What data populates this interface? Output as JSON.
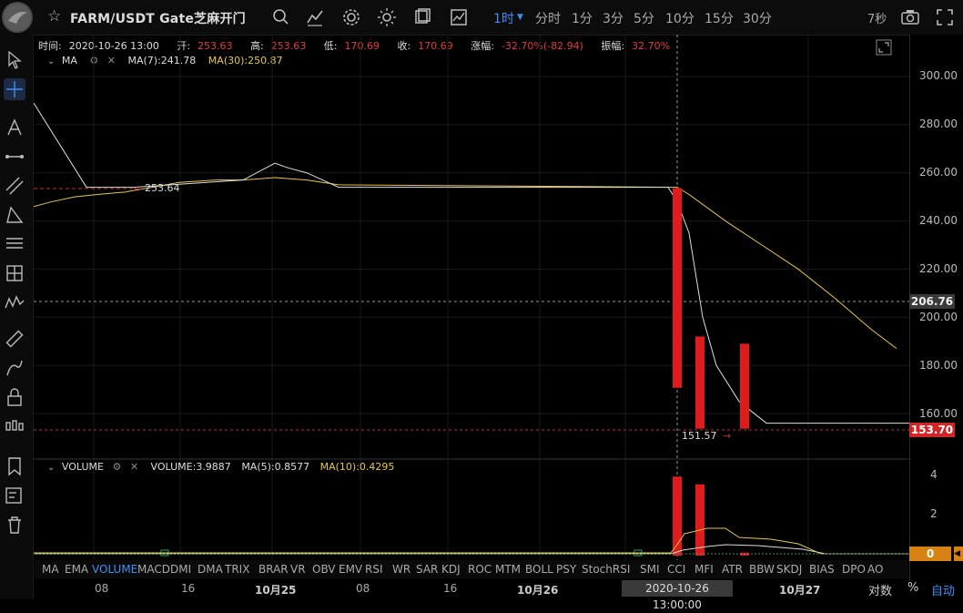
{
  "header": {
    "symbol": "FARM/USDT Gate芝麻开门",
    "timeframes": [
      {
        "label": "1时",
        "active": true
      },
      {
        "label": "分时"
      },
      {
        "label": "1分"
      },
      {
        "label": "3分"
      },
      {
        "label": "5分"
      },
      {
        "label": "10分"
      },
      {
        "label": "15分"
      },
      {
        "label": "30分"
      }
    ],
    "refresh": "7秒",
    "icons": [
      "star-icon",
      "search-icon",
      "indicator-icon",
      "settings-icon",
      "theme-icon",
      "copy-icon",
      "chart-icon",
      "camera-icon",
      "fullscreen-icon"
    ]
  },
  "ohlc": {
    "time_label": "时间:",
    "time": "2020-10-26 13:00",
    "open_label": "开:",
    "open": "253.63",
    "high_label": "高:",
    "high": "253.63",
    "low_label": "低:",
    "low": "170.69",
    "close_label": "收:",
    "close": "170.69",
    "change_label": "涨幅:",
    "change": "-32.70%(-82.94)",
    "amp_label": "振幅:",
    "amp": "32.70%"
  },
  "ma_legend": {
    "name": "MA",
    "ma7": "MA(7):241.78",
    "ma30": "MA(30):250.87"
  },
  "vol_legend": {
    "name": "VOLUME",
    "vol": "VOLUME:3.9887",
    "ma5": "MA(5):0.8577",
    "ma10": "MA(10):0.4295"
  },
  "price_axis": {
    "labels": [
      "300.00",
      "280.00",
      "260.00",
      "240.00",
      "220.00",
      "200.00",
      "180.00",
      "160.00"
    ],
    "crosshair_price": "206.76",
    "last_price": "153.70",
    "high_annotation": "253.64",
    "low_annotation": "151.57"
  },
  "volume_axis": {
    "labels": [
      "4",
      "2"
    ],
    "last_volume": "0"
  },
  "indicators": [
    "MA",
    "EMA",
    "VOLUME",
    "MACD",
    "DMI",
    "DMA",
    "TRIX",
    "BRAR",
    "VR",
    "OBV",
    "EMV",
    "RSI",
    "WR",
    "SAR",
    "KDJ",
    "ROC",
    "MTM",
    "BOLL",
    "PSY",
    "StochRSI",
    "SMI",
    "CCI",
    "MFI",
    "ATR",
    "BBW",
    "SKDJ",
    "BIAS",
    "DPO",
    "AO"
  ],
  "active_indicator": "VOLUME",
  "time_axis": {
    "labels": [
      {
        "text": "08"
      },
      {
        "text": "16"
      },
      {
        "text": "10月25",
        "bold": true
      },
      {
        "text": "08"
      },
      {
        "text": "16"
      },
      {
        "text": "10月26",
        "bold": true
      },
      {
        "text": "10月27",
        "bold": true
      }
    ],
    "crosshair_time": "2020-10-26 13:00:00"
  },
  "bottom_right": {
    "log": "对数",
    "percent": "%",
    "auto": "自动"
  },
  "colors": {
    "up": "#e01b1b",
    "ma7": "#dddddd",
    "ma30": "#e6c64a",
    "accent": "#3f8ef5",
    "last_price_tag": "#d22525",
    "volume_tag": "#d98214"
  },
  "chart_data": {
    "type": "candlestick",
    "candles": [
      {
        "x": "2020-10-26 13:00",
        "open": 253.63,
        "high": 253.63,
        "low": 170.69,
        "close": 170.69
      },
      {
        "x": "2020-10-26 14:00",
        "open": 192.0,
        "high": 192.0,
        "low": 153.7,
        "close": 153.7
      },
      {
        "x": "2020-10-26 16:00",
        "open": 189.0,
        "high": 189.0,
        "low": 153.7,
        "close": 153.7
      }
    ],
    "volume": [
      {
        "x": "2020-10-26 13:00",
        "value": 3.9887
      },
      {
        "x": "2020-10-26 14:00",
        "value": 3.6
      },
      {
        "x": "2020-10-26 16:00",
        "value": 0.15
      }
    ],
    "ylim": [
      150,
      305
    ],
    "volume_ylim": [
      0,
      4.5
    ]
  }
}
